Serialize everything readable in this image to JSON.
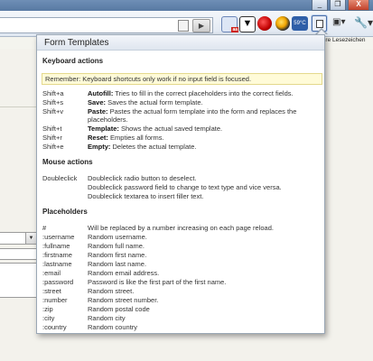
{
  "bookmarks": {
    "label": "tere Lesezeichen"
  },
  "url": {
    "go_icon": "play-icon"
  },
  "popup": {
    "title": "Form Templates",
    "keyboard": {
      "heading": "Keyboard actions",
      "note": "Remember: Keyboard shortcuts only work if no input field is focused.",
      "items": [
        {
          "key": "Shift+a",
          "bold": "Autofill:",
          "text": " Tries to fill in the correct placeholders into the correct fields."
        },
        {
          "key": "Shift+s",
          "bold": "Save:",
          "text": " Saves the actual form template."
        },
        {
          "key": "Shift+v",
          "bold": "Paste:",
          "text": " Pastes the actual form template into the form and replaces the placeholders."
        },
        {
          "key": "Shift+t",
          "bold": "Template:",
          "text": " Shows the actual saved template."
        },
        {
          "key": "Shift+r",
          "bold": "Reset:",
          "text": " Empties all forms."
        },
        {
          "key": "Shift+e",
          "bold": "Empty:",
          "text": " Deletes the actual template."
        }
      ]
    },
    "mouse": {
      "heading": "Mouse actions",
      "key": "Doubleclick",
      "lines": [
        "Doubleclick radio button to deselect.",
        "Doubleclick password field to change to text type and vice versa.",
        "Doubleclick textarea to insert filler text."
      ]
    },
    "placeholders": {
      "heading": "Placeholders",
      "items": [
        {
          "key": "#",
          "text": "Will be replaced by a number increasing on each page reload."
        },
        {
          "key": ":username",
          "text": "Random username."
        },
        {
          "key": ":fullname",
          "text": "Random full name."
        },
        {
          "key": ":firstname",
          "text": "Random first name."
        },
        {
          "key": ":lastname",
          "text": "Random last name."
        },
        {
          "key": ":email",
          "text": "Random email address."
        },
        {
          "key": ":password",
          "text": "Password is like the first part of the first name."
        },
        {
          "key": ":street",
          "text": "Random street."
        },
        {
          "key": ":number",
          "text": "Random street number."
        },
        {
          "key": ":zip",
          "text": "Random postal code"
        },
        {
          "key": ":city",
          "text": "Random city"
        },
        {
          "key": ":country",
          "text": "Random country"
        }
      ]
    }
  },
  "toolbar": {
    "ext_badge": "aa",
    "ext5_label": "59°C",
    "window_min": "_",
    "window_restore": "❐",
    "window_close": "X"
  }
}
